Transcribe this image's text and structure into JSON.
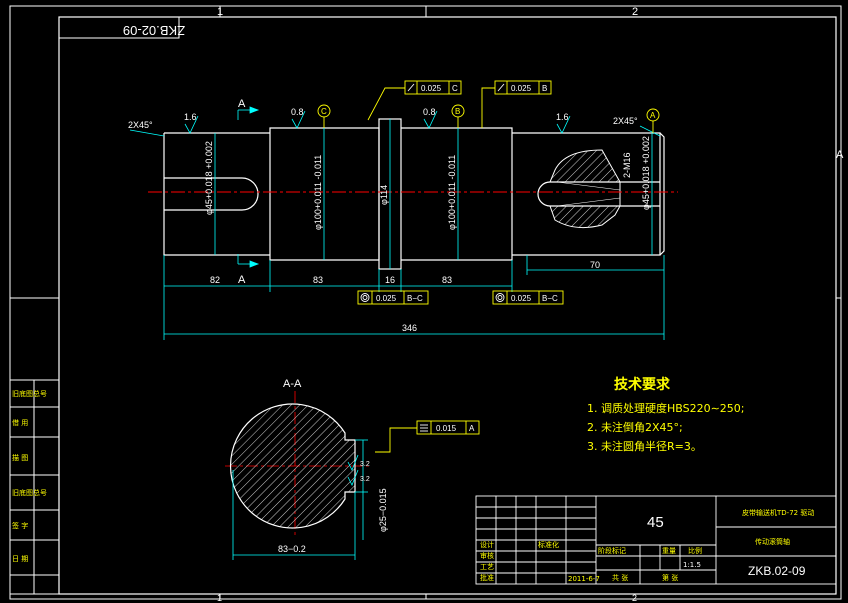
{
  "border": {
    "zone_top": [
      "1",
      "2"
    ],
    "zone_bottom": [
      "1",
      "2"
    ],
    "zone_side": "A",
    "drawing_number_rotated": "ZKB.02-09"
  },
  "left_strip": [
    "旧底图总号",
    "借 用",
    "描 图",
    "旧底图总号",
    "签 字",
    "日 期"
  ],
  "view_labels": {
    "section_arrow_top": "A",
    "section_arrow_bottom": "A",
    "section_title": "A-A",
    "datum_a": "A",
    "datum_b": "B",
    "datum_c": "C"
  },
  "chamfers": {
    "left": "2X45°",
    "right": "2X45°"
  },
  "roughness": [
    "1.6",
    "0.8",
    "0.8",
    "1.6"
  ],
  "diameters": {
    "d1": "φ45+0.018 +0.002",
    "d2": "φ100+0.011 -0.011",
    "d3": "φ114",
    "d4": "φ100+0.011 -0.011",
    "d5": "φ45+0.018 +0.002",
    "thread": "2-M16"
  },
  "lengths": {
    "l1": "82",
    "l2": "83",
    "l3": "16",
    "l4": "83",
    "l5": "70",
    "total": "346"
  },
  "tolerances": {
    "runout_c_value": "0.025",
    "runout_c_datum": "C",
    "runout_b_value": "0.025",
    "runout_b_datum": "B",
    "conc_1_value": "0.025",
    "conc_1_datum": "B−C",
    "conc_2_value": "0.025",
    "conc_2_datum": "B−C",
    "sym_value": "0.015",
    "sym_datum": "A"
  },
  "section_dims": {
    "width": "83−0.2",
    "key": "φ25−0.015",
    "rough_a": "3.2",
    "rough_b": "3.2"
  },
  "requirements": {
    "title": "技术要求",
    "items": [
      "1.  调质处理硬度HBS220∼250;",
      "2.  未注倒角2X45°;",
      "3.  未注圆角半径R=3。"
    ]
  },
  "title_block": {
    "material": "45",
    "product": "皮带输送机TD-72 驱动",
    "part_name": "传动滚筒轴",
    "drawing_no": "ZKB.02-09",
    "scale": "1:1.5",
    "date": "2011-6-7",
    "labels": {
      "designer": "设计",
      "checker": "审核",
      "process": "工艺",
      "standard": "标准化",
      "approve": "批准",
      "stage": "阶段标记",
      "weight": "重量",
      "ratio": "比例",
      "sheet": "共 张",
      "page": "第 张"
    }
  },
  "colors": {
    "outline": "#ffffff",
    "dimension": "#00ffff",
    "center": "#ff0000",
    "annotation": "#ffff00"
  }
}
